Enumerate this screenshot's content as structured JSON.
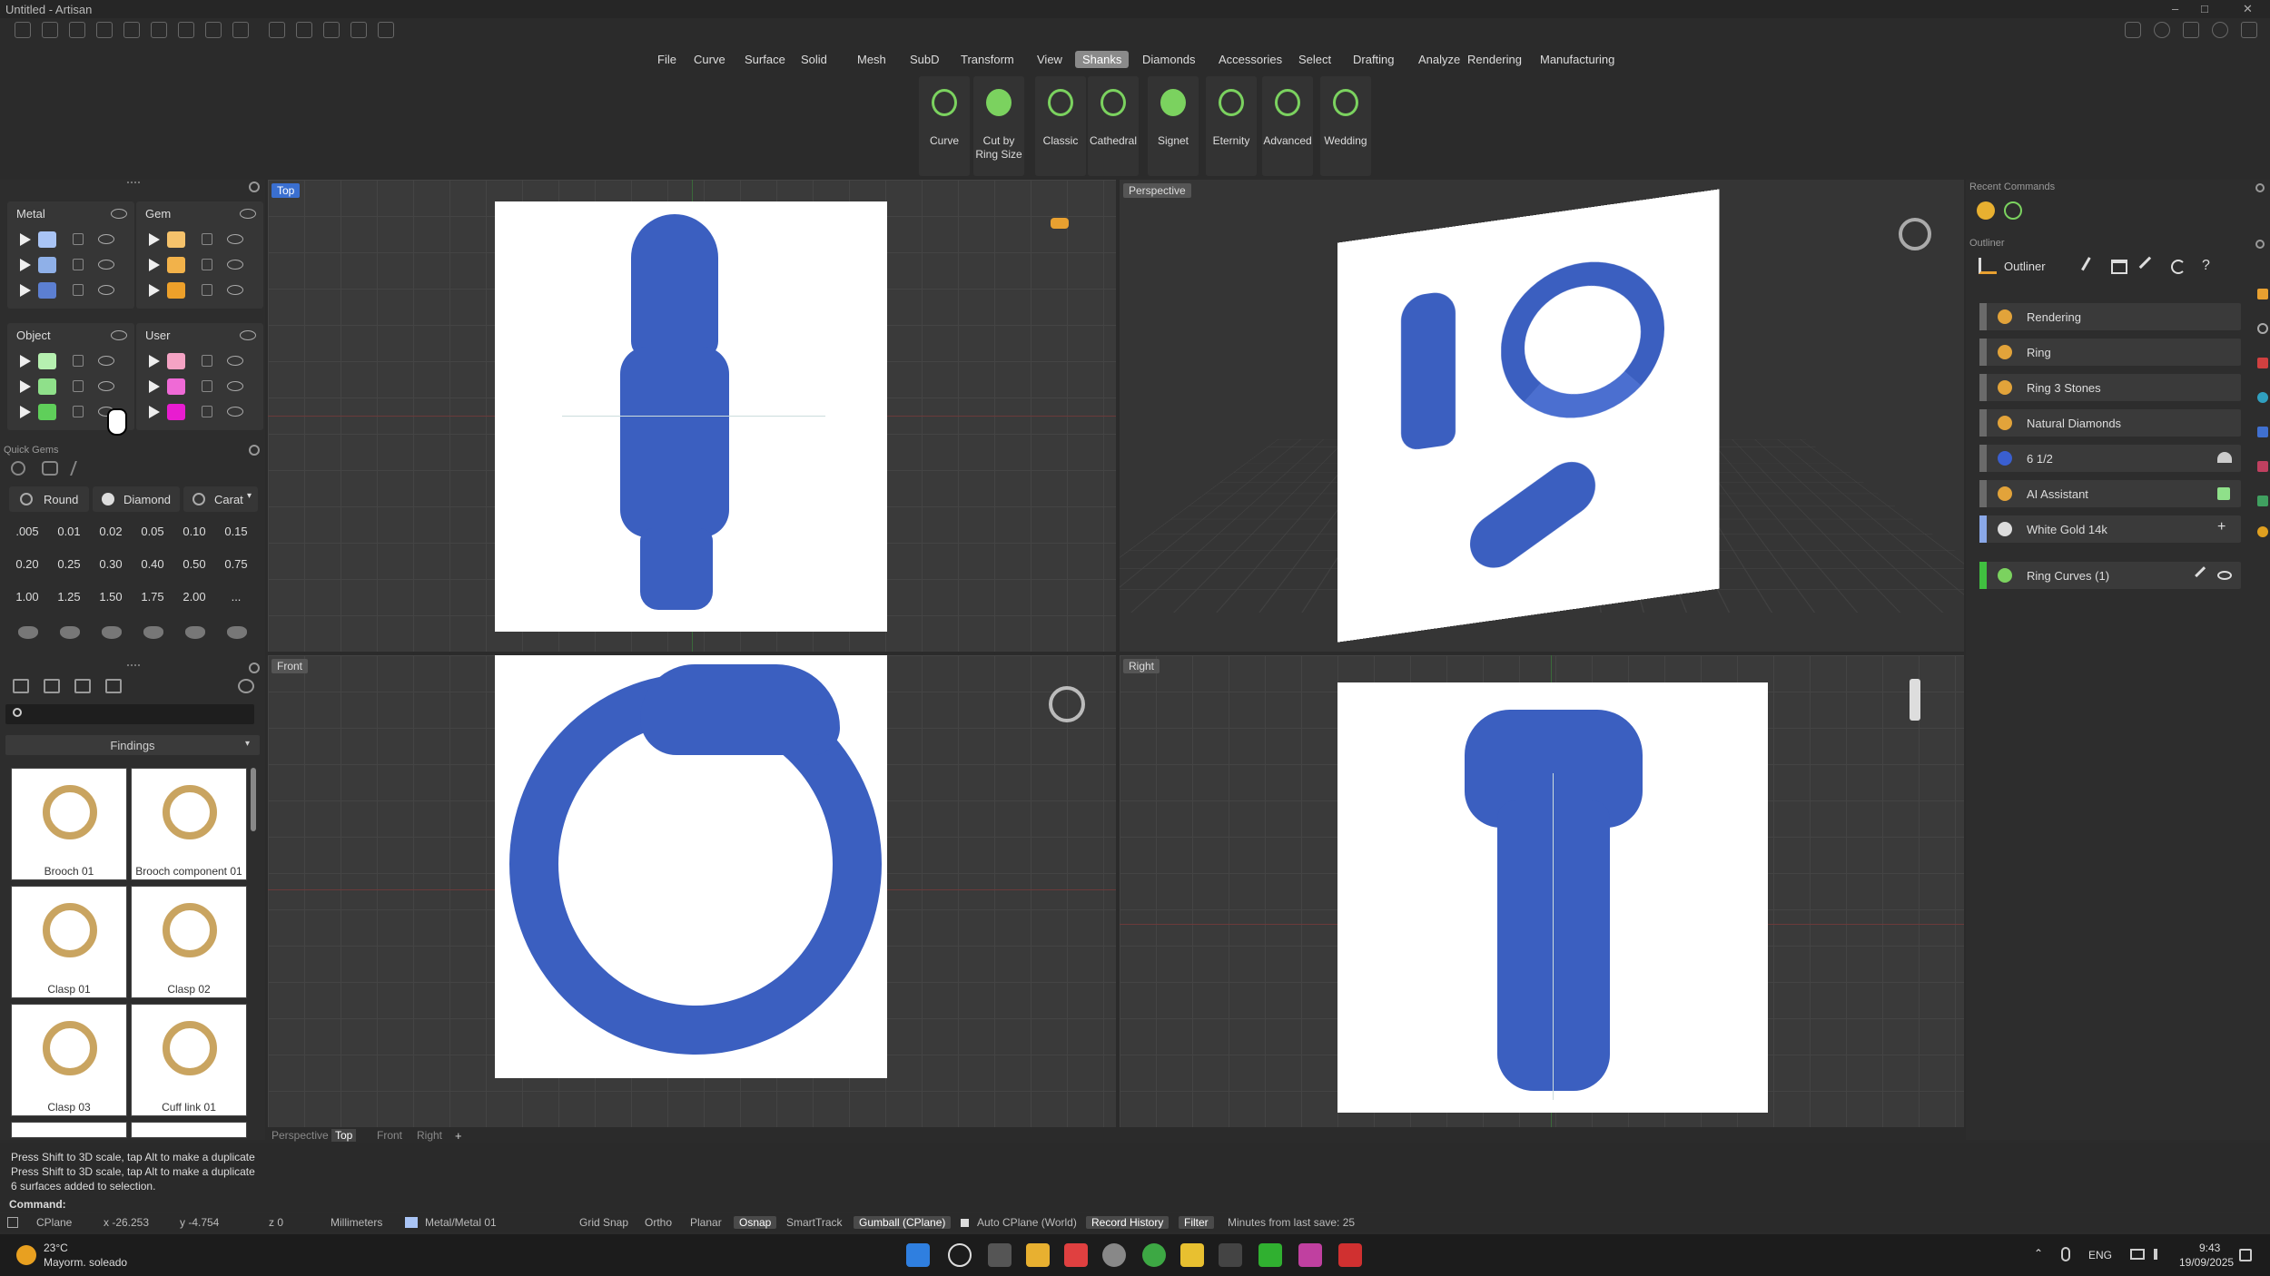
{
  "window": {
    "title": "Untitled - Artisan"
  },
  "menus": [
    "File",
    "Curve",
    "Surface",
    "Solid",
    "Mesh",
    "SubD",
    "Transform",
    "View",
    "Shanks",
    "Diamonds",
    "Accessories",
    "Select",
    "Drafting",
    "Analyze",
    "Rendering",
    "Manufacturing"
  ],
  "active_menu": "Shanks",
  "tools": [
    {
      "label": "Curve",
      "icon": "curve-icon"
    },
    {
      "label": "Cut by Ring Size",
      "icon": "ring-size-icon"
    },
    {
      "label": "Classic",
      "icon": "classic-shank-icon"
    },
    {
      "label": "Cathedral",
      "icon": "cathedral-shank-icon"
    },
    {
      "label": "Signet",
      "icon": "signet-shank-icon"
    },
    {
      "label": "Eternity",
      "icon": "eternity-shank-icon"
    },
    {
      "label": "Advanced",
      "icon": "advanced-shank-icon"
    },
    {
      "label": "Wedding",
      "icon": "wedding-shank-icon"
    }
  ],
  "layers": {
    "metal": {
      "label": "Metal",
      "colors": [
        "#a9c4f5",
        "#8fb0e8",
        "#5c7fd1"
      ]
    },
    "gem": {
      "label": "Gem",
      "colors": [
        "#f5c26b",
        "#f2b24a",
        "#eda02a"
      ]
    },
    "object": {
      "label": "Object",
      "colors": [
        "#b6f0b0",
        "#8fe08a",
        "#5fcf5a"
      ]
    },
    "user": {
      "label": "User",
      "colors": [
        "#f5a3c4",
        "#ef6ad6",
        "#e81cd0"
      ]
    }
  },
  "quick_gems": {
    "title": "Quick Gems",
    "shape": "Round",
    "material": "Diamond",
    "unit": "Carat",
    "values": [
      ".005",
      "0.01",
      "0.02",
      "0.05",
      "0.10",
      "0.15",
      "0.20",
      "0.25",
      "0.30",
      "0.40",
      "0.50",
      "0.75",
      "1.00",
      "1.25",
      "1.50",
      "1.75",
      "2.00",
      "..."
    ]
  },
  "library": {
    "category": "Findings",
    "search_placeholder": "",
    "items": [
      "Brooch 01",
      "Brooch component 01",
      "Clasp 01",
      "Clasp 02",
      "Clasp 03",
      "Cuff link 01"
    ]
  },
  "viewports": {
    "top": "Top",
    "perspective": "Perspective",
    "front": "Front",
    "right": "Right"
  },
  "viewport_tabs": [
    "Perspective",
    "Top",
    "Front",
    "Right"
  ],
  "viewport_tab_active": "Top",
  "recent_commands": {
    "title": "Recent Commands"
  },
  "outliner": {
    "title": "Outliner",
    "header_label": "Outliner",
    "rows": [
      {
        "label": "Rendering",
        "icon": "palette-icon"
      },
      {
        "label": "Ring",
        "icon": "ring-icon"
      },
      {
        "label": "Ring 3 Stones",
        "icon": "stones-icon"
      },
      {
        "label": "Natural Diamonds",
        "icon": "diamond-icon"
      },
      {
        "label": "6 1/2",
        "icon": "us-flag-icon"
      },
      {
        "label": "AI Assistant",
        "icon": "ai-icon"
      },
      {
        "label": "White Gold 14k",
        "icon": "metal-icon"
      },
      {
        "label": "Ring Curves (1)",
        "icon": "curve-icon"
      }
    ]
  },
  "command_history": [
    "Press Shift to 3D scale, tap Alt to make a duplicate",
    "Press Shift to 3D scale, tap Alt to make a duplicate",
    "6 surfaces added to selection."
  ],
  "command_prompt": "Command:",
  "status": {
    "cplane": "CPlane",
    "x": "x -26.253",
    "y": "y -4.754",
    "z": "z 0",
    "units": "Millimeters",
    "layer": "Metal/Metal 01",
    "grid_snap": "Grid Snap",
    "ortho": "Ortho",
    "planar": "Planar",
    "osnap": "Osnap",
    "smarttrack": "SmartTrack",
    "gumball": "Gumball (CPlane)",
    "auto_cplane": "Auto CPlane (World)",
    "record_history": "Record History",
    "filter": "Filter",
    "last_save": "Minutes from last save: 25"
  },
  "taskbar": {
    "temp": "23°C",
    "weather": "Mayorm. soleado",
    "lang": "ENG",
    "time": "9:43",
    "date": "19/09/2025"
  }
}
